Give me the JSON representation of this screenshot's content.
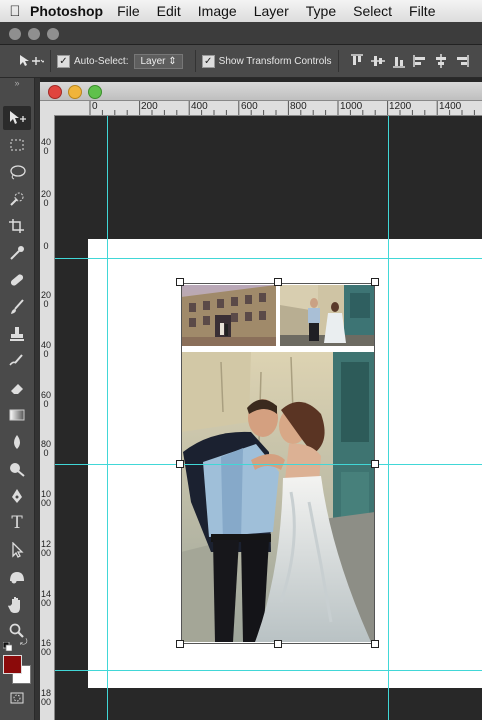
{
  "menubar": {
    "apple_icon": "apple-icon",
    "app_name": "Photoshop",
    "items": [
      "File",
      "Edit",
      "Image",
      "Layer",
      "Type",
      "Select",
      "Filte"
    ]
  },
  "options": {
    "auto_select_label": "Auto-Select:",
    "auto_select_checked": true,
    "auto_select_value": "Layer",
    "show_transform_label": "Show Transform Controls",
    "show_transform_checked": true
  },
  "ruler": {
    "top_labels": [
      "0",
      "200",
      "400",
      "600",
      "800",
      "1000",
      "1200",
      "1400"
    ],
    "left_labels": [
      "400",
      "200",
      "0",
      "200",
      "400",
      "600",
      "800",
      "1000",
      "1200",
      "1400",
      "1600",
      "1800"
    ]
  },
  "tools": [
    "move-tool-icon",
    "marquee-tool-icon",
    "lasso-tool-icon",
    "quick-select-tool-icon",
    "crop-tool-icon",
    "eyedropper-tool-icon",
    "healing-brush-icon",
    "brush-tool-icon",
    "clone-stamp-icon",
    "history-brush-icon",
    "eraser-tool-icon",
    "gradient-tool-icon",
    "blur-tool-icon",
    "dodge-tool-icon",
    "pen-tool-icon",
    "type-tool-icon",
    "path-selection-icon",
    "shape-tool-icon",
    "hand-tool-icon",
    "zoom-tool-icon"
  ],
  "colors": {
    "foreground": "#8b0a0a",
    "background": "#ffffff",
    "guide": "#41d7d7"
  }
}
